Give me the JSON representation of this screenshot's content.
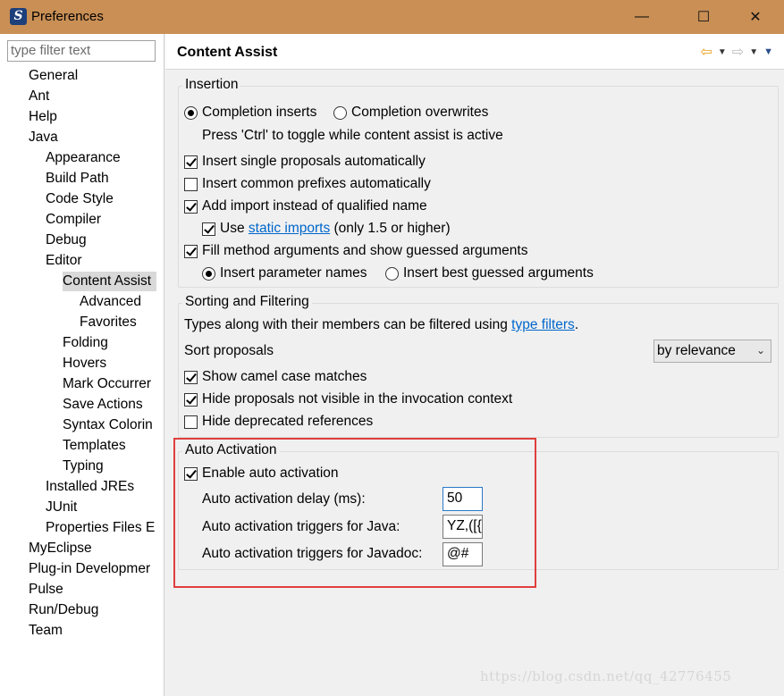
{
  "window": {
    "title": "Preferences"
  },
  "controls": {
    "minimize": "—",
    "maximize": "☐",
    "close": "✕"
  },
  "sidebar": {
    "filter_placeholder": "type filter text",
    "items": [
      {
        "label": "General",
        "depth": 0
      },
      {
        "label": "Ant",
        "depth": 0
      },
      {
        "label": "Help",
        "depth": 0
      },
      {
        "label": "Java",
        "depth": 0
      },
      {
        "label": "Appearance",
        "depth": 1
      },
      {
        "label": "Build Path",
        "depth": 1
      },
      {
        "label": "Code Style",
        "depth": 1
      },
      {
        "label": "Compiler",
        "depth": 1
      },
      {
        "label": "Debug",
        "depth": 1
      },
      {
        "label": "Editor",
        "depth": 1
      },
      {
        "label": "Content Assist",
        "depth": 2,
        "selected": true
      },
      {
        "label": "Advanced",
        "depth": 3
      },
      {
        "label": "Favorites",
        "depth": 3
      },
      {
        "label": "Folding",
        "depth": 2
      },
      {
        "label": "Hovers",
        "depth": 2
      },
      {
        "label": "Mark Occurrer",
        "depth": 2
      },
      {
        "label": "Save Actions",
        "depth": 2
      },
      {
        "label": "Syntax Colorin",
        "depth": 2
      },
      {
        "label": "Templates",
        "depth": 2
      },
      {
        "label": "Typing",
        "depth": 2
      },
      {
        "label": "Installed JREs",
        "depth": 1
      },
      {
        "label": "JUnit",
        "depth": 1
      },
      {
        "label": "Properties Files E",
        "depth": 1
      },
      {
        "label": "MyEclipse",
        "depth": 0
      },
      {
        "label": "Plug-in Developmer",
        "depth": 0
      },
      {
        "label": "Pulse",
        "depth": 0
      },
      {
        "label": "Run/Debug",
        "depth": 0
      },
      {
        "label": "Team",
        "depth": 0
      }
    ]
  },
  "main": {
    "title": "Content Assist",
    "nav": {
      "back": "⇦",
      "forward": "⇨",
      "caret": "▼",
      "menu": "▼"
    },
    "insertion": {
      "title": "Insertion",
      "radio_completion_inserts": "Completion inserts",
      "radio_completion_overwrites": "Completion overwrites",
      "toggle_hint": "Press 'Ctrl' to toggle while content assist is active",
      "insert_single": "Insert single proposals automatically",
      "insert_common": "Insert common prefixes automatically",
      "add_import": "Add import instead of qualified name",
      "use_prefix": "Use",
      "static_imports_link": "static imports",
      "use_suffix": "(only 1.5 or higher)",
      "fill_method": "Fill method arguments and show guessed arguments",
      "insert_param_names": "Insert parameter names",
      "insert_best_guessed": "Insert best guessed arguments"
    },
    "sorting": {
      "title": "Sorting and Filtering",
      "types_text": "Types along with their members can be filtered using",
      "type_filters_link": "type filters",
      "period": ".",
      "sort_label": "Sort proposals",
      "sort_value": "by relevance",
      "show_camel": "Show camel case matches",
      "hide_not_visible": "Hide proposals not visible in the invocation context",
      "hide_deprecated": "Hide deprecated references"
    },
    "auto_activation": {
      "title": "Auto Activation",
      "enable": "Enable auto activation",
      "delay_label": "Auto activation delay (ms):",
      "delay_value": "50",
      "java_label": "Auto activation triggers for Java:",
      "java_value": "YZ,([{",
      "javadoc_label": "Auto activation triggers for Javadoc:",
      "javadoc_value": "@#"
    }
  },
  "watermark": "https://blog.csdn.net/qq_42776455",
  "colors": {
    "titlebar": "#c98f55",
    "highlight": "#e13e3e",
    "link": "#0066cc"
  }
}
